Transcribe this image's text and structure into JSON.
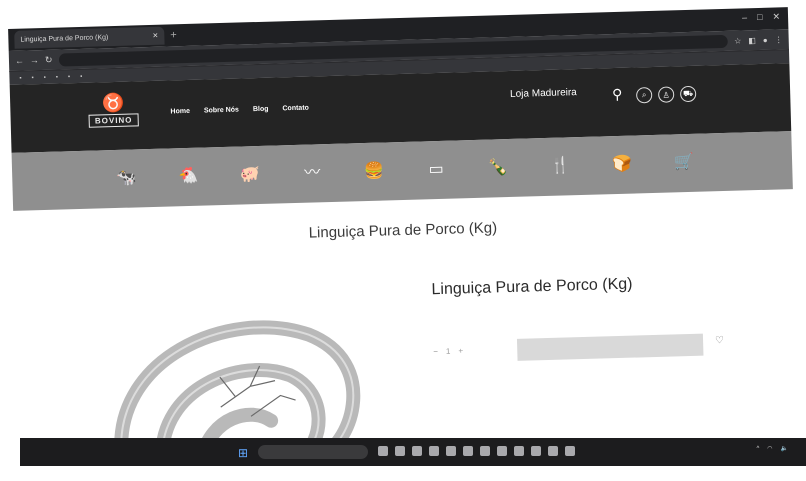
{
  "browser": {
    "tab_title": "Linguiça Pura de Porco (Kg)",
    "url": "",
    "bookmarks": []
  },
  "site": {
    "brand": "BOVINO",
    "nav": [
      "Home",
      "Sobre Nós",
      "Blog",
      "Contato"
    ],
    "store_label": "",
    "store_name": "Loja Madureira"
  },
  "categories": [
    "",
    "",
    "",
    "",
    "",
    "",
    "",
    "",
    "",
    ""
  ],
  "page": {
    "title": "Linguiça Pura de Porco (Kg)",
    "product_title": "Linguiça Pura de Porco (Kg)",
    "price": "",
    "quantity": "1",
    "buy_label": "",
    "meta": ""
  },
  "taskbar": {
    "weather": "",
    "search_placeholder": "",
    "time": "",
    "date": ""
  },
  "icons": {
    "tab_close": "close-icon",
    "search": "search-icon",
    "user": "user-icon",
    "cart": "cart-icon",
    "location": "location-pin-icon",
    "favorite": "heart-icon"
  }
}
